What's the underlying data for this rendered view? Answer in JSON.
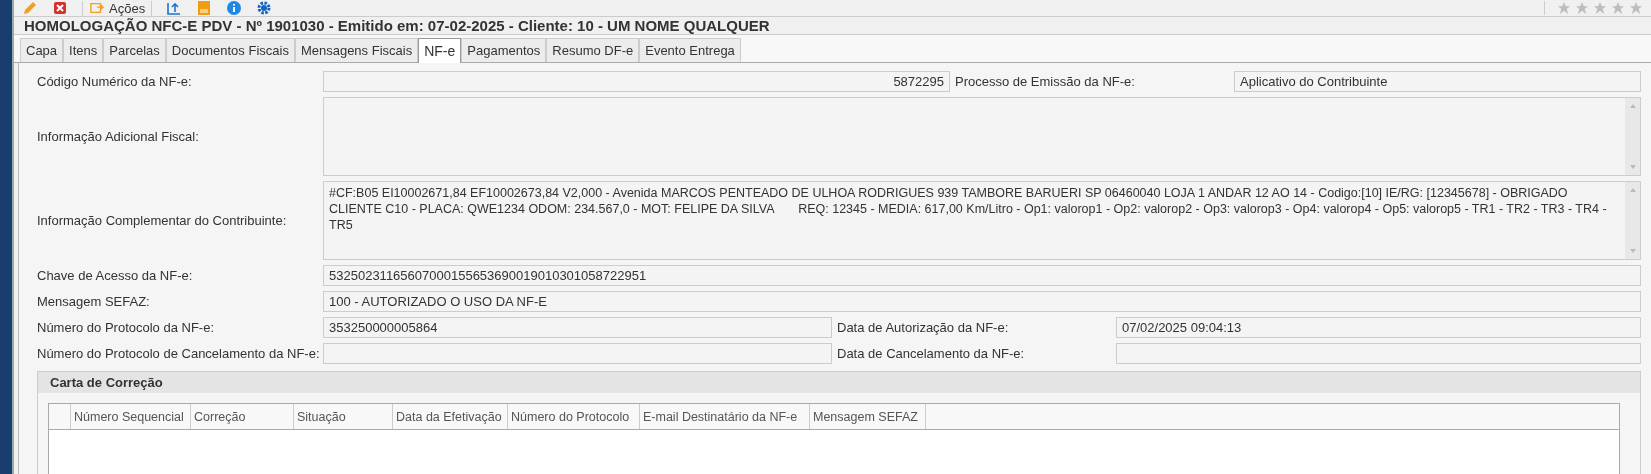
{
  "toolbar": {
    "items": [
      {
        "kind": "pencil"
      },
      {
        "kind": "delete"
      },
      {
        "kind": "actions",
        "label": "Ações"
      },
      {
        "kind": "upload"
      },
      {
        "kind": "folder"
      },
      {
        "kind": "info"
      },
      {
        "kind": "settings"
      }
    ],
    "rating": {
      "stars": 0
    }
  },
  "title": "HOMOLOGAÇÃO NFC-E PDV - Nº 1901030 - Emitido em: 07-02-2025 - Cliente: 10 - UM NOME QUALQUER",
  "tabs": [
    {
      "label": "Capa",
      "selected": false
    },
    {
      "label": "Itens",
      "selected": false
    },
    {
      "label": "Parcelas",
      "selected": false
    },
    {
      "label": "Documentos Fiscais",
      "selected": false
    },
    {
      "label": "Mensagens Fiscais",
      "selected": false
    },
    {
      "label": "NF-e",
      "selected": true
    },
    {
      "label": "Pagamentos",
      "selected": false
    },
    {
      "label": "Resumo DF-e",
      "selected": false
    },
    {
      "label": "Evento Entrega",
      "selected": false
    }
  ],
  "rows": [
    {
      "fields": [
        {
          "label": "Código Numérico da NF-e:",
          "value": "5872295",
          "kind": "number"
        },
        {
          "label": "Processo de Emissão da NF-e:",
          "value": "Aplicativo do Contribuinte",
          "kind": "text"
        }
      ]
    },
    {
      "fields": [
        {
          "label": "Informação Adicional Fiscal:",
          "kind": "textarea"
        }
      ]
    },
    {
      "fields": [
        {
          "label": "Informação Complementar do Contribuinte:",
          "value": "#CF:B05 EI10002671,84 EF10002673,84 V2,000 - Avenida MARCOS PENTEADO DE ULHOA RODRIGUES 939 TAMBORE BARUERI SP 06460040 LOJA 1 ANDAR 12 AO 14 - Codigo:[10] IE/RG: [12345678] - OBRIGADO CLIENTE C10 - PLACA: QWE1234 ODOM: 234.567,0 - MOT: FELIPE DA SILVA       REQ: 12345 - MEDIA: 617,00 Km/Litro - Op1: valorop1 - Op2: valorop2 - Op3: valorop3 - Op4: valorop4 - Op5: valorop5 - TR1 - TR2 - TR3 - TR4 - TR5",
          "kind": "textarea"
        }
      ]
    },
    {
      "fields": [
        {
          "label": "Chave de Acesso da NF-e:",
          "value": "53250231165607000155653690019010301058722951",
          "kind": "text"
        }
      ]
    },
    {
      "fields": [
        {
          "label": "Mensagem SEFAZ:",
          "value": "100 - AUTORIZADO O USO DA NF-E",
          "kind": "text"
        }
      ]
    },
    {
      "fields": [
        {
          "label": "Número do Protocolo da NF-e:",
          "value": "353250000005864",
          "kind": "text"
        },
        {
          "label": "Data de Autorização da NF-e:",
          "value": "07/02/2025 09:04:13",
          "kind": "text"
        }
      ]
    },
    {
      "fields": [
        {
          "label": "Número do Protocolo de Cancelamento da NF-e:",
          "kind": "text"
        },
        {
          "label": "Data de Cancelamento da NF-e:",
          "kind": "text"
        }
      ]
    }
  ],
  "carta_de_correcao": {
    "title": "Carta de Correção",
    "columns": [
      "Número Sequencial",
      "Correção",
      "Situação",
      "Data da Efetivação",
      "Número do Protocolo",
      "E-mail Destinatário da NF-e",
      "Mensagem SEFAZ"
    ]
  }
}
